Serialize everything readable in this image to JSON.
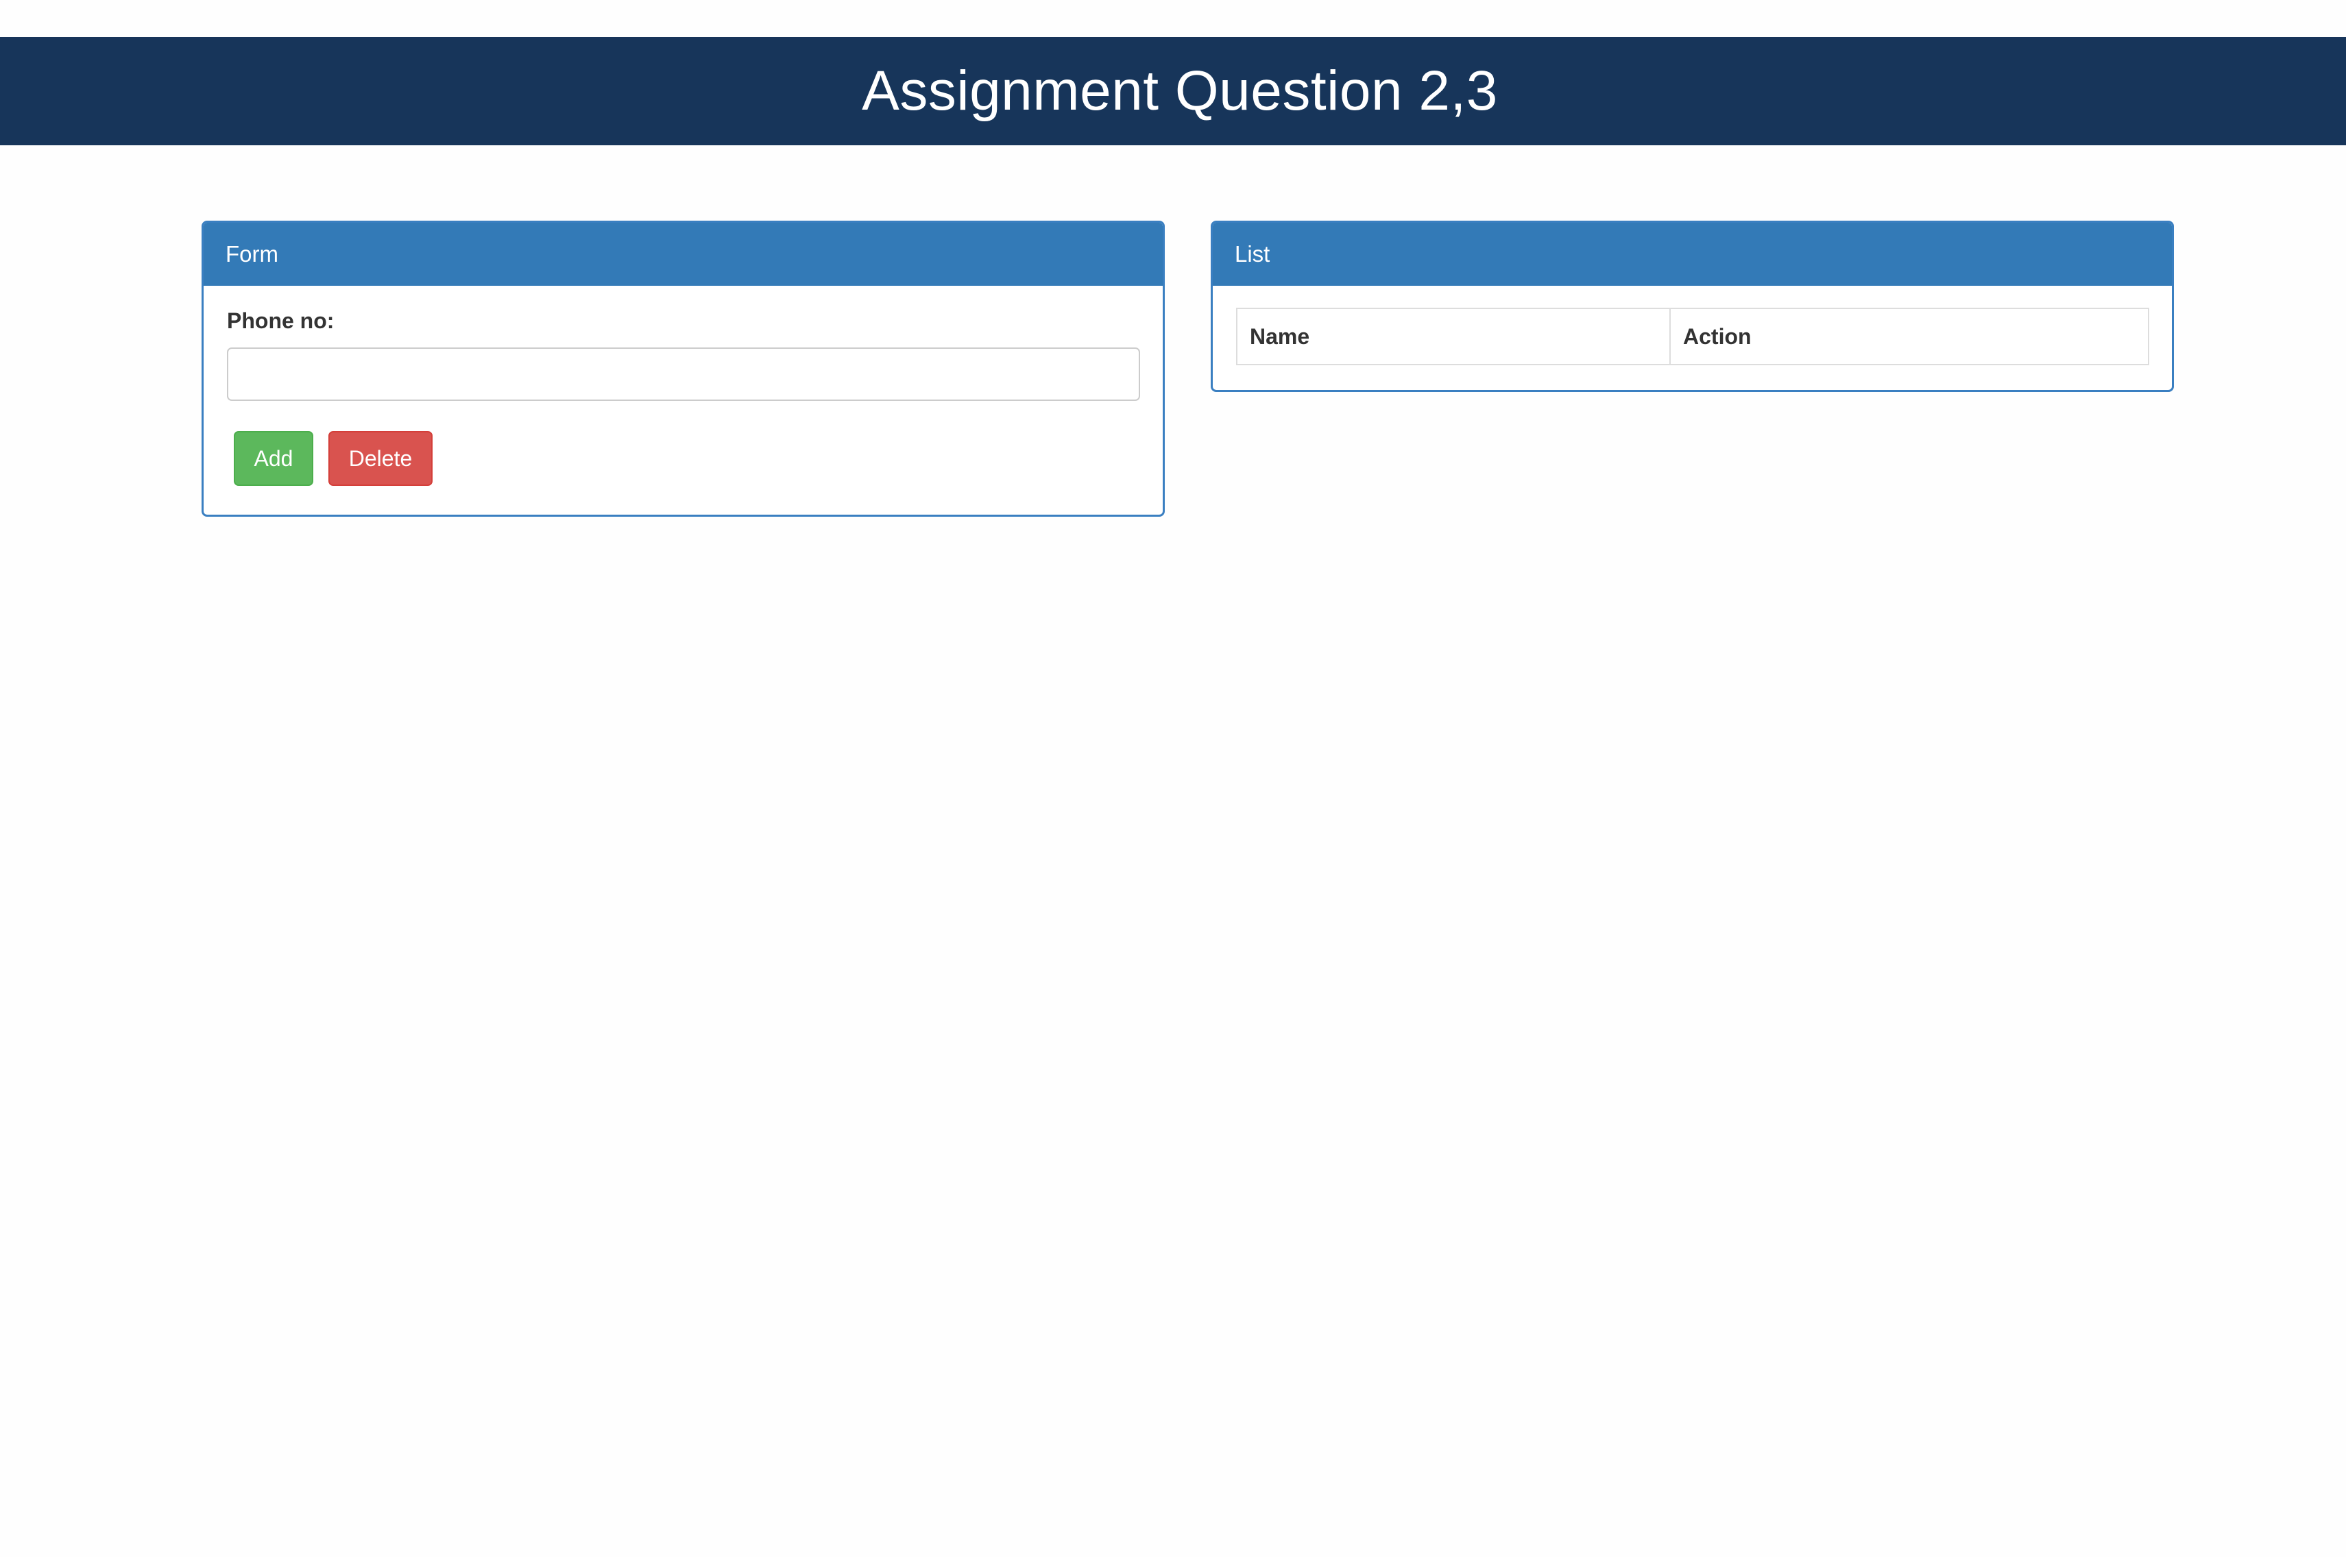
{
  "header": {
    "title": "Assignment Question 2,3"
  },
  "form_panel": {
    "heading": "Form",
    "phone_label": "Phone no:",
    "phone_value": "",
    "phone_placeholder": "",
    "add_label": "Add",
    "delete_label": "Delete"
  },
  "list_panel": {
    "heading": "List",
    "columns": [
      "Name",
      "Action"
    ],
    "rows": []
  },
  "colors": {
    "header_bg": "#17355a",
    "panel_heading_bg": "#337ab7",
    "add_button": "#5cb85c",
    "delete_button": "#d9534f"
  }
}
